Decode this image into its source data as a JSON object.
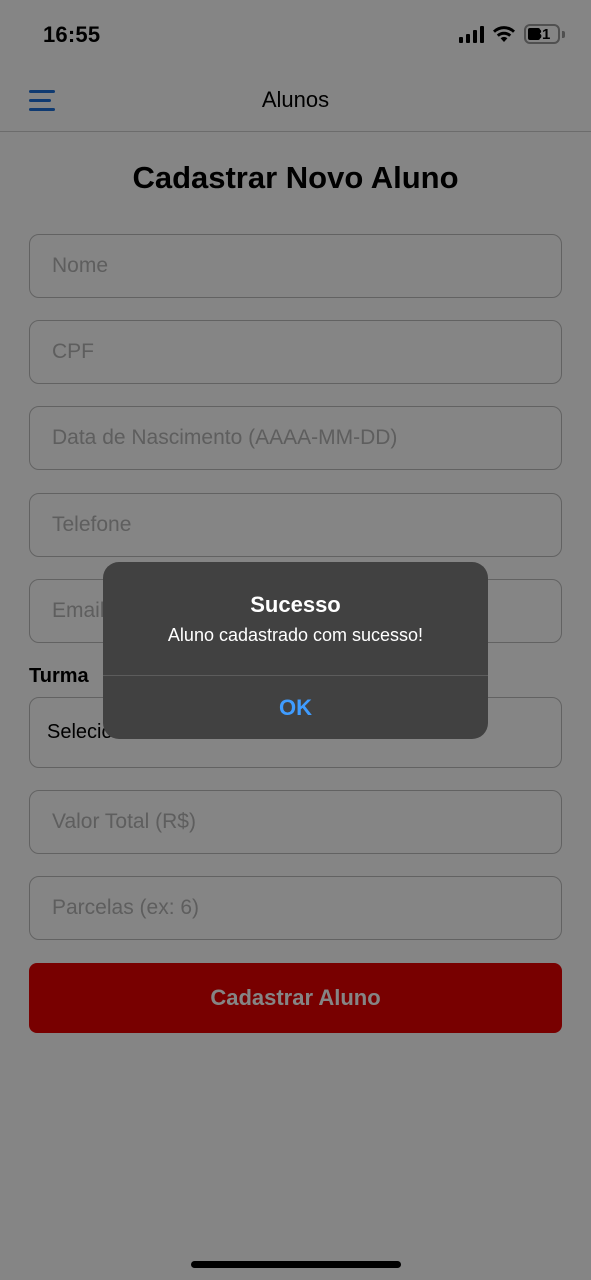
{
  "status_bar": {
    "time": "16:55",
    "battery": "31"
  },
  "header": {
    "title": "Alunos",
    "menu_icon": "hamburger-menu-icon"
  },
  "form": {
    "title": "Cadastrar Novo Aluno",
    "fields": {
      "nome": {
        "placeholder": "Nome",
        "value": ""
      },
      "cpf": {
        "placeholder": "CPF",
        "value": ""
      },
      "nascimento": {
        "placeholder": "Data de Nascimento (AAAA-MM-DD)",
        "value": ""
      },
      "telefone": {
        "placeholder": "Telefone",
        "value": ""
      },
      "email": {
        "placeholder": "Email",
        "value": ""
      },
      "valor_total": {
        "placeholder": "Valor Total (R$)",
        "value": ""
      },
      "parcelas": {
        "placeholder": "Parcelas (ex: 6)",
        "value": ""
      }
    },
    "turma_label": "Turma",
    "turma_selected": "Selecione a Turma",
    "submit_label": "Cadastrar Aluno",
    "accent_color": "#e60000"
  },
  "alert": {
    "title": "Sucesso",
    "message": "Aluno cadastrado com sucesso!",
    "ok_label": "OK",
    "ok_color": "#3f9cff"
  }
}
